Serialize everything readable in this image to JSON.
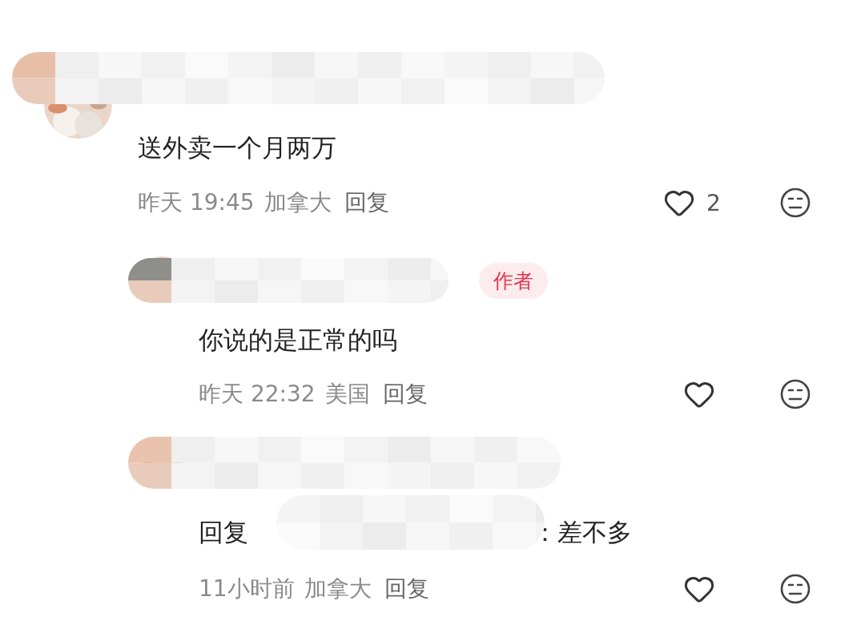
{
  "comments": [
    {
      "kind": "top",
      "text": "送外卖一个月两万",
      "time": "昨天 19:45",
      "location": "加拿大",
      "reply_label": "回复",
      "likes": "2"
    },
    {
      "kind": "reply",
      "badge": "作者",
      "text": "你说的是正常的吗",
      "time": "昨天 22:32",
      "location": "美国",
      "reply_label": "回复"
    },
    {
      "kind": "reply",
      "reply_prefix": "回复",
      "text": "：差不多",
      "time": "11小时前",
      "location": "加拿大",
      "reply_label": "回复"
    }
  ]
}
